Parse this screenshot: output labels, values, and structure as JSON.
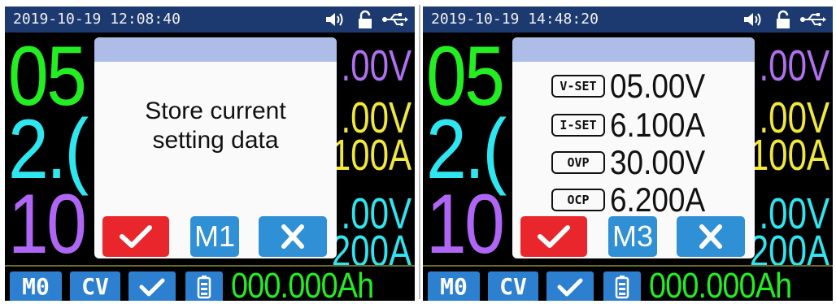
{
  "left": {
    "datetime": "2019-10-19 12:08:40",
    "big_voltage": "05",
    "big_current": "2.(",
    "big_power": "10",
    "side1": ".00V",
    "side2": ".00V",
    "side3": "100A",
    "side4": ".00V",
    "side5": "200A",
    "dialog": {
      "line1": "Store current",
      "line2": "setting data",
      "mem_label": "M1"
    },
    "bottom": {
      "mem": "M0",
      "mode": "CV",
      "ah": "000.000Ah"
    }
  },
  "right": {
    "datetime": "2019-10-19 14:48:20",
    "big_voltage": "05",
    "big_current": "2.(",
    "big_power": "10",
    "side1": ".00V",
    "side2": ".00V",
    "side3": "100A",
    "side4": ".00V",
    "side5": "200A",
    "dialog": {
      "params": [
        {
          "tag": "V-SET",
          "value": "05.00V"
        },
        {
          "tag": "I-SET",
          "value": "6.100A"
        },
        {
          "tag": "OVP",
          "value": "30.00V"
        },
        {
          "tag": "OCP",
          "value": "6.200A"
        }
      ],
      "mem_label": "M3"
    },
    "bottom": {
      "mem": "M0",
      "mode": "CV",
      "ah": "000.000Ah"
    }
  },
  "icons": {
    "speaker": "speaker-icon",
    "lock": "lock-icon",
    "usb": "usb-icon",
    "check": "check-icon",
    "close": "close-icon",
    "battery": "battery-icon"
  },
  "colors": {
    "voltage": "#22ee22",
    "current": "#2ee6f0",
    "power": "#b066f5",
    "set": "#f0e83a",
    "confirm": "#e8262b",
    "accent": "#2f90d6",
    "topbar": "#1d3a70"
  }
}
